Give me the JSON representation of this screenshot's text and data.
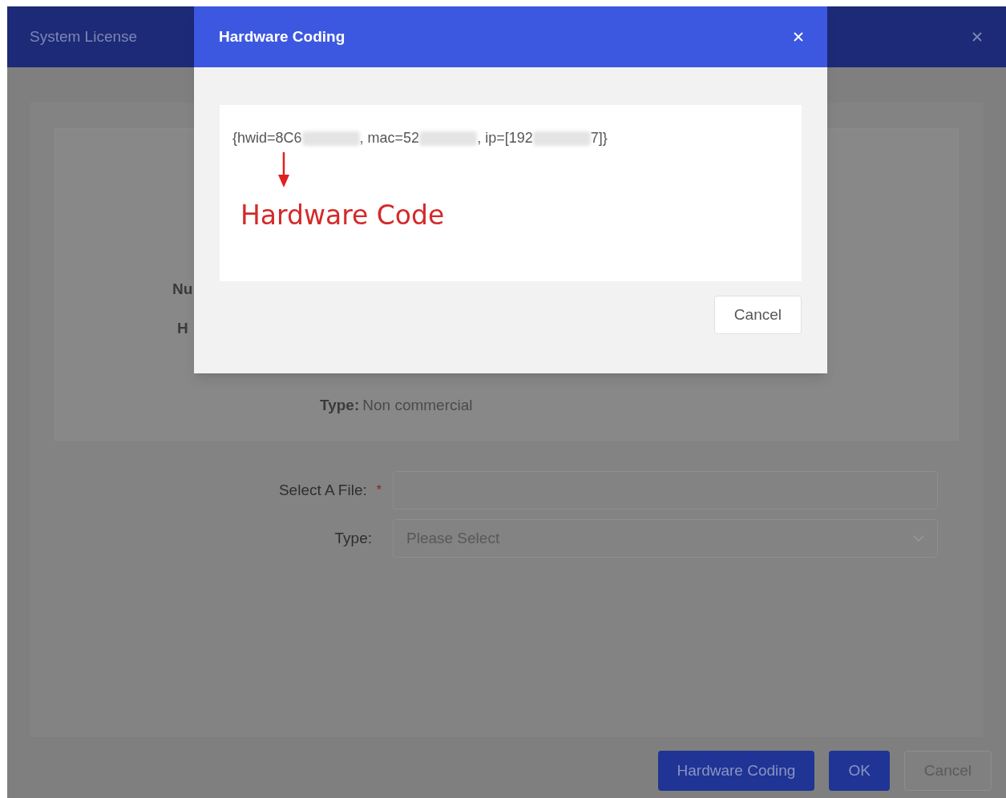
{
  "dialog": {
    "title": "System License",
    "info": [
      {
        "label": "Nu"
      },
      {
        "label": "H"
      },
      {
        "label": "Type:",
        "value": "Non commercial"
      }
    ],
    "form": [
      {
        "kind": "file",
        "label": "Select A File:",
        "required": true,
        "required_mark": "*"
      },
      {
        "kind": "select",
        "label": "Type:",
        "required": false,
        "placeholder": "Please Select"
      }
    ],
    "buttons": [
      {
        "label": "Hardware Coding",
        "primary": true
      },
      {
        "label": "OK",
        "primary": true
      },
      {
        "label": "Cancel",
        "primary": false
      }
    ]
  },
  "modal": {
    "title": "Hardware Coding",
    "code_parts": [
      {
        "text": "{hwid=8C6",
        "blurred_after": true
      },
      {
        "text": ", mac=52",
        "blurred_after": true
      },
      {
        "text": ", ip=[192",
        "blurred_after": true
      },
      {
        "text": "7]}",
        "blurred_after": false
      }
    ],
    "annotation": "Hardware Code",
    "buttons": [
      {
        "label": "Cancel"
      }
    ]
  }
}
